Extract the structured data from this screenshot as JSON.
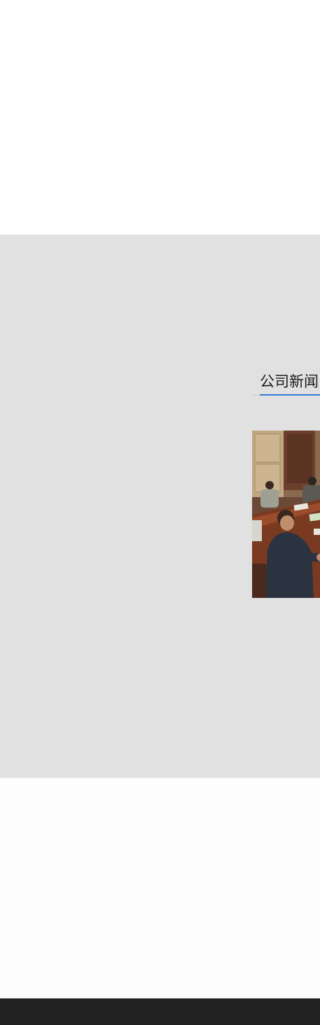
{
  "news": {
    "title": "公司新闻"
  },
  "colors": {
    "section_bg": "#e2e1e2",
    "accent_underline": "#2f7bd6",
    "footer_bg": "#222222"
  },
  "icons": {
    "news_photo": "meeting-photo"
  }
}
